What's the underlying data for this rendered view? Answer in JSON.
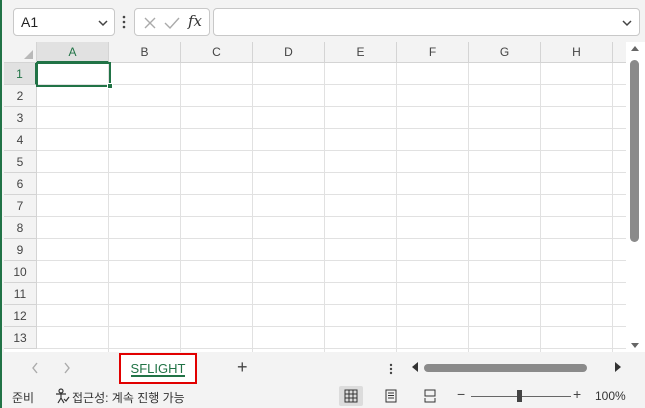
{
  "name_box": {
    "value": "A1"
  },
  "formula_bar": {
    "value": ""
  },
  "columns": [
    "A",
    "B",
    "C",
    "D",
    "E",
    "F",
    "G",
    "H"
  ],
  "rows": [
    "1",
    "2",
    "3",
    "4",
    "5",
    "6",
    "7",
    "8",
    "9",
    "10",
    "11",
    "12",
    "13"
  ],
  "selected_cell": "A1",
  "sheets": [
    {
      "label": "SFLIGHT",
      "active": true
    }
  ],
  "status": {
    "ready": "준비",
    "accessibility": "접근성: 계속 진행 가능",
    "zoom": "100%",
    "zoom_minus": "−",
    "zoom_plus": "+",
    "add_sheet": "+"
  },
  "colors": {
    "accent": "#217346",
    "highlight": "#e10000"
  },
  "icons": [
    "chevron-down-icon",
    "more-vertical-icon",
    "cancel-icon",
    "enter-icon",
    "function-icon",
    "accessibility-icon",
    "normal-view-icon",
    "page-layout-icon",
    "page-break-icon"
  ]
}
